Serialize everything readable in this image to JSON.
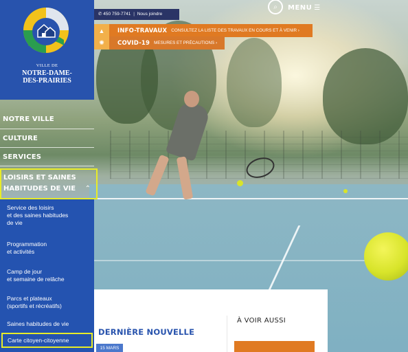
{
  "contact": {
    "phone": "450 759-7741",
    "link": "Nous joindre"
  },
  "header": {
    "menu_label": "MENU",
    "search_icon": "search-icon",
    "menu_icon": "hamburger-icon"
  },
  "alerts": [
    {
      "title": "INFO-TRAVAUX",
      "link": "CONSULTEZ LA LISTE DES TRAVAUX EN COURS ET À VENIR ›",
      "icon": "traffic-cone-icon"
    },
    {
      "title": "COVID-19",
      "link": "MESURES ET PRÉCAUTIONS ›",
      "icon": "virus-icon"
    }
  ],
  "logo": {
    "line_small": "VILLE DE",
    "line_big_1": "NOTRE-DAME-",
    "line_big_2": "DES-PRAIRIES"
  },
  "nav": {
    "items": [
      "NOTRE VILLE",
      "CULTURE",
      "SERVICES"
    ],
    "active_line_1": "LOISIRS ET SAINES",
    "active_line_2": "HABITUDES DE VIE",
    "active_icon": "chevron-up-icon"
  },
  "submenu": [
    {
      "l1": "Service des loisirs",
      "l2": "et des saines habitudes",
      "l3": "de vie"
    },
    {
      "l1": "Programmation",
      "l2": "et activités"
    },
    {
      "l1": "Camp de jour",
      "l2": "et semaine de relâche"
    },
    {
      "l1": "Parcs et plateaux",
      "l2": "(sportifs et récréatifs)"
    },
    {
      "l1": "Saines habitudes de vie"
    },
    {
      "l1": "Carte citoyen-citoyenne"
    }
  ],
  "content": {
    "news_title": "DERNIÈRE NOUVELLE",
    "date": "15 MARS",
    "see_also": "À VOIR AUSSI"
  },
  "colors": {
    "brand_blue": "#2853ad",
    "accent_orange": "#e07a22",
    "highlight_yellow": "#e8ec27",
    "dark_navy": "#2a3466"
  }
}
